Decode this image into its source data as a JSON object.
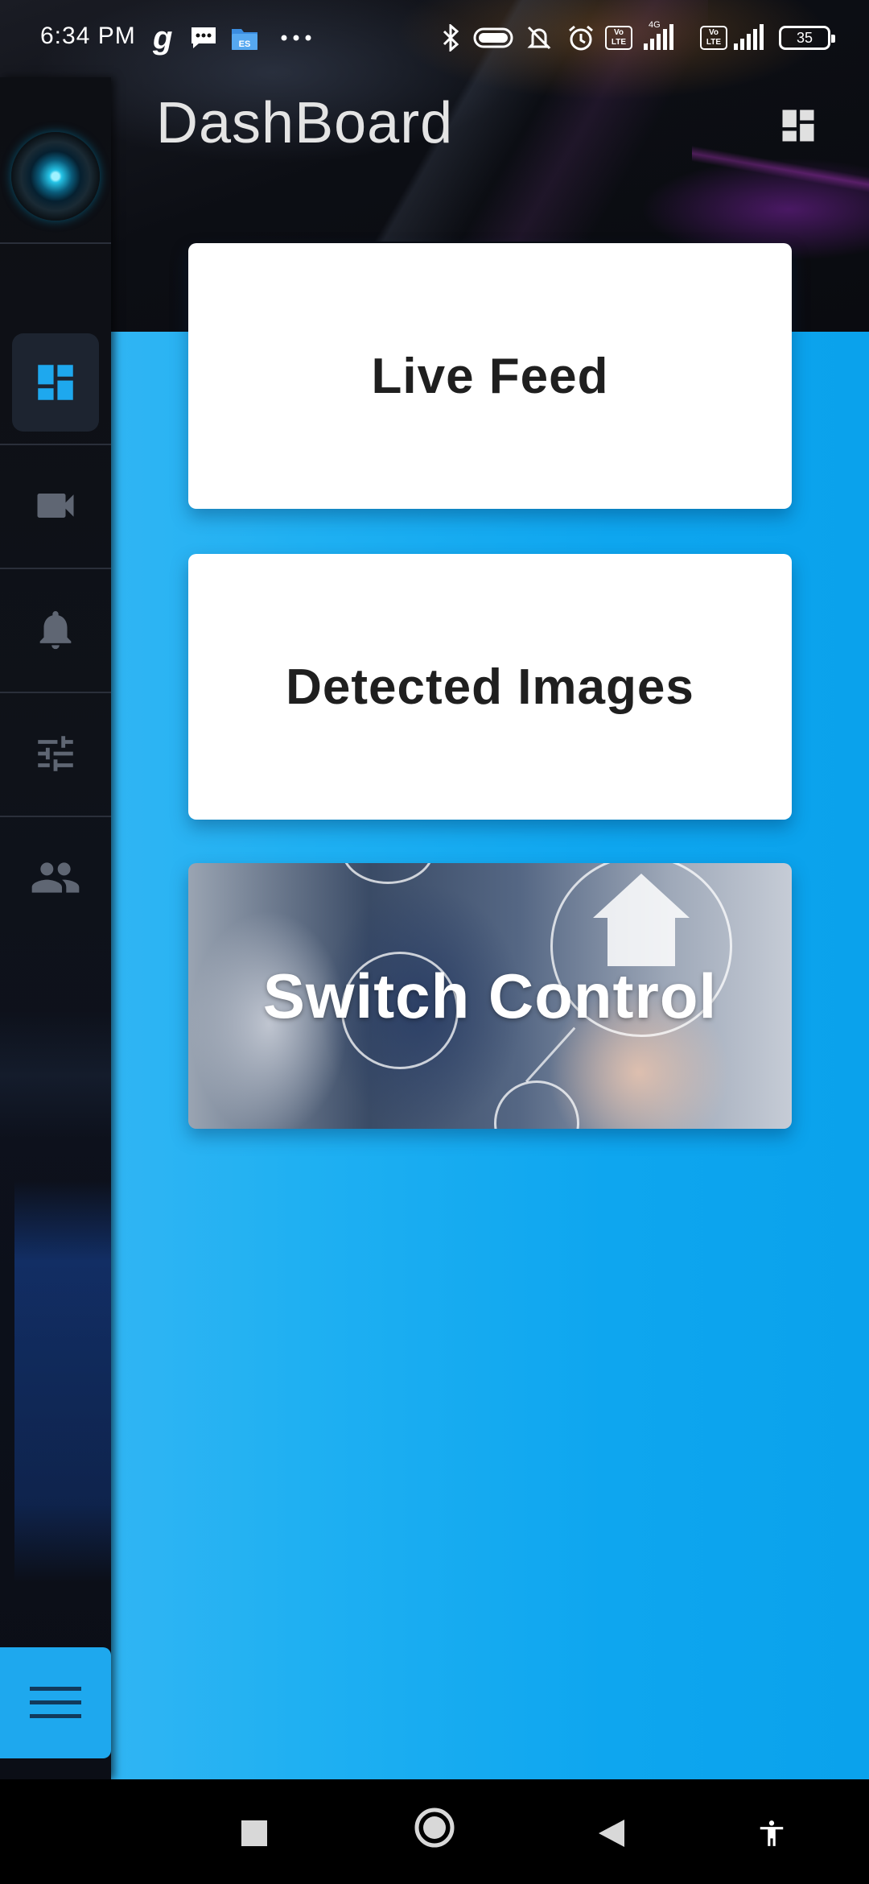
{
  "status_bar": {
    "time": "6:34 PM",
    "notification_icons": [
      "gaana-icon",
      "message-icon",
      "file-explorer-icon",
      "more-dots-icon"
    ],
    "system_icons": [
      "bluetooth-icon",
      "toggle-icon",
      "mute-icon",
      "alarm-icon",
      "volte-icon",
      "signal-icon",
      "volte-icon",
      "signal-icon"
    ],
    "network_label": "4G",
    "volte_label": "Vo LTE",
    "battery": "35"
  },
  "header": {
    "title": "DashBoard",
    "action_icon": "dashboard-icon"
  },
  "sidebar": {
    "items": [
      {
        "icon": "dashboard-icon",
        "active": true
      },
      {
        "icon": "videocam-icon",
        "active": false
      },
      {
        "icon": "bell-icon",
        "active": false
      },
      {
        "icon": "sliders-icon",
        "active": false
      },
      {
        "icon": "people-icon",
        "active": false
      }
    ],
    "menu_icon": "hamburger-menu-icon"
  },
  "cards": [
    {
      "label": "Live Feed"
    },
    {
      "label": "Detected Images"
    },
    {
      "label": "Switch Control"
    }
  ],
  "nav_bar": [
    "recents-square-icon",
    "home-circle-icon",
    "back-triangle-icon",
    "accessibility-icon"
  ],
  "colors": {
    "accent": "#1ea8ee",
    "main_background": "#0ea6ef",
    "sidebar_background": "#0f1219",
    "card_background": "#ffffff",
    "icon_gray": "#6b7280",
    "active_icon": "#1ea8ee"
  }
}
